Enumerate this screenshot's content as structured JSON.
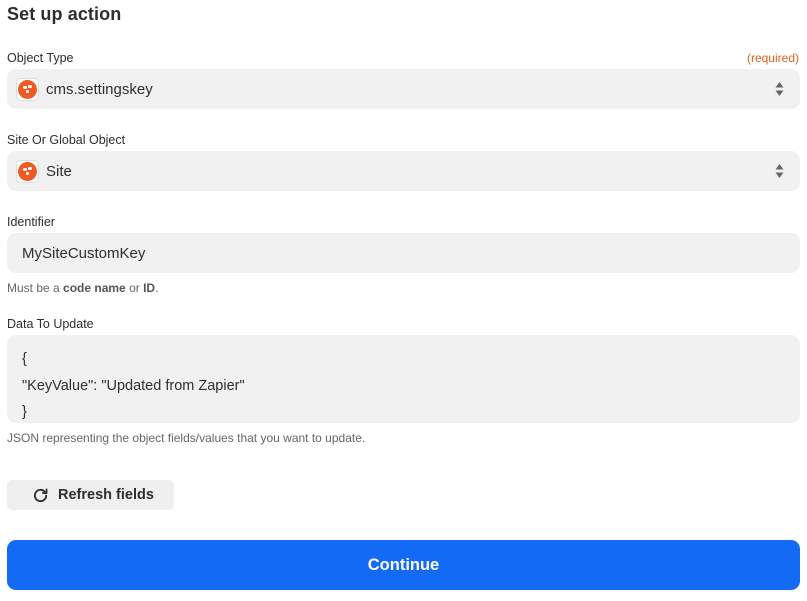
{
  "header": {
    "title": "Set up action"
  },
  "fields": {
    "object_type": {
      "label": "Object Type",
      "required_text": "(required)",
      "value": "cms.settingskey",
      "icon": "kentico-app-icon"
    },
    "site_or_global": {
      "label": "Site Or Global Object",
      "value": "Site",
      "icon": "kentico-app-icon"
    },
    "identifier": {
      "label": "Identifier",
      "value": "MySiteCustomKey",
      "help_prefix": "Must be a ",
      "help_code_name": "code name",
      "help_or": " or ",
      "help_id": "ID",
      "help_suffix": "."
    },
    "data_to_update": {
      "label": "Data To Update",
      "lines": [
        "{",
        "\"KeyValue\": \"Updated from Zapier\"",
        "}"
      ],
      "help": "JSON representing the object fields/values that you want to update."
    }
  },
  "actions": {
    "refresh_label": "Refresh fields",
    "continue_label": "Continue"
  },
  "colors": {
    "accent": "#136bf5",
    "required": "#e0611f",
    "app_brand": "#ee5a24",
    "field_bg": "#f1f1f1"
  }
}
